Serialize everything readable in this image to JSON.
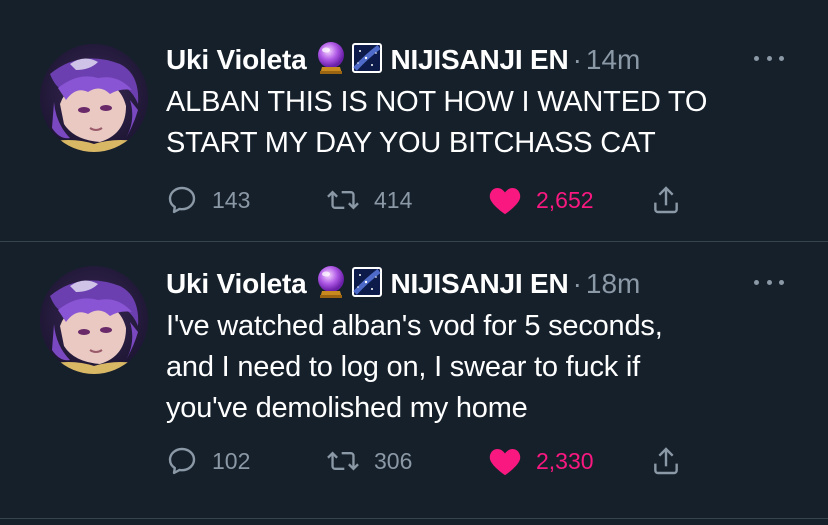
{
  "tweets": [
    {
      "author": "Uki Violeta",
      "emoji": "🔮",
      "affiliation": "NIJISANJI EN",
      "separator": "·",
      "time": "14m",
      "text": "ALBAN THIS IS NOT HOW I WANTED TO\nSTART MY DAY YOU BITCHASS CAT",
      "replies": "143",
      "retweets": "414",
      "likes": "2,652"
    },
    {
      "author": "Uki Violeta",
      "emoji": "🔮",
      "affiliation": "NIJISANJI EN",
      "separator": "·",
      "time": "18m",
      "text": "I've watched alban's vod for 5 seconds,\nand I need to log on, I swear to fuck if\nyou've demolished my home",
      "replies": "102",
      "retweets": "306",
      "likes": "2,330"
    }
  ],
  "icons": {
    "more": "more-dots-icon",
    "reply": "reply-bubble-icon",
    "retweet": "retweet-icon",
    "like": "heart-icon",
    "share": "share-icon",
    "affiliation_badge": "night-sky-badge-icon",
    "emoji": "crystal-ball-icon"
  },
  "colors": {
    "background": "#15202b",
    "divider": "#38444d",
    "muted": "#8b98a5",
    "like": "#f91880",
    "text": "#ffffff"
  }
}
